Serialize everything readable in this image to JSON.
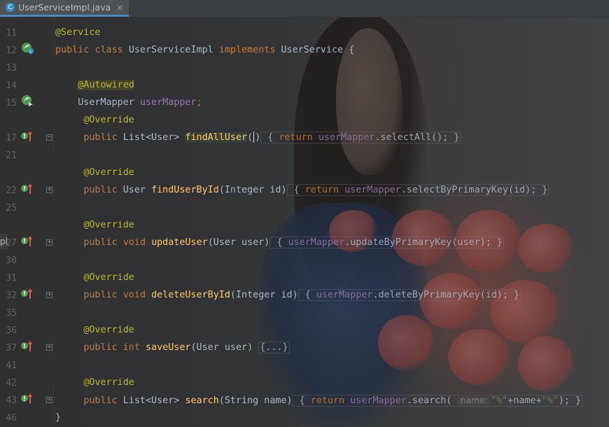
{
  "tab": {
    "icon_letter": "C",
    "filename": "UserServiceImpl.java",
    "close": "×"
  },
  "side_label": "pl",
  "gutter": {
    "lines": [
      "11",
      "12",
      "13",
      "14",
      "15",
      "17",
      "21",
      "22",
      "25",
      "27",
      "30",
      "31",
      "32",
      "35",
      "36",
      "37",
      "41",
      "42",
      "43",
      "46"
    ]
  },
  "code": {
    "l0": {
      "ann": "@Service"
    },
    "l1": {
      "kw1": "public",
      "kw2": "class",
      "name": "UserServiceImpl",
      "kw3": "implements",
      "iface": "UserService",
      "brace": "{"
    },
    "l3": {
      "ann": "@Autowired"
    },
    "l4": {
      "type": "UserMapper",
      "field": "userMapper",
      "semi": ";"
    },
    "m1": {
      "ann": "@Override",
      "kw": "public",
      "ret": "List<User>",
      "name": "findAllUser",
      "params1": "(",
      "params2": ")",
      "body_open": " { ",
      "ret_kw": "return",
      "field": "userMapper",
      "call": ".selectAll();",
      "close": " }"
    },
    "m2": {
      "ann": "@Override",
      "kw": "public",
      "ret": "User",
      "name": "findUserById",
      "params": "(Integer id)",
      "body_open": " { ",
      "ret_kw": "return",
      "field": "userMapper",
      "call": ".selectByPrimaryKey(id);",
      "close": " }"
    },
    "m3": {
      "ann": "@Override",
      "kw": "public",
      "kw2": "void",
      "name": "updateUser",
      "params": "(User user)",
      "body_open": " { ",
      "field": "userMapper",
      "call": ".updateByPrimaryKey(user);",
      "close": " }"
    },
    "m4": {
      "ann": "@Override",
      "kw": "public",
      "kw2": "void",
      "name": "deleteUserById",
      "params": "(Integer id)",
      "body_open": " { ",
      "field": "userMapper",
      "call": ".deleteByPrimaryKey(id);",
      "close": " }"
    },
    "m5": {
      "ann": "@Override",
      "kw": "public",
      "kw2": "int",
      "name": "saveUser",
      "params": "(User user)",
      "folded": "{...}"
    },
    "m6": {
      "ann": "@Override",
      "kw": "public",
      "ret": "List<User>",
      "name": "search",
      "params": "(String name)",
      "body_open": " { ",
      "ret_kw": "return",
      "field": "userMapper",
      "call": ".search(",
      "hint": "name:",
      "str1": "\"%\"",
      "concat": "+name+",
      "str2": "\"%\"",
      "call_end": ");",
      "close": " }"
    },
    "end": {
      "brace": "}"
    }
  },
  "colors": {
    "keyword": "#cc7832",
    "annotation": "#bbb529",
    "field": "#9876aa",
    "method": "#ffc66d",
    "string": "#6a8759",
    "text": "#a9b7c6",
    "line_number": "#606366"
  },
  "icons": {
    "spring_bean": "spring-bean-icon",
    "implementation": "implementing-method-icon"
  }
}
